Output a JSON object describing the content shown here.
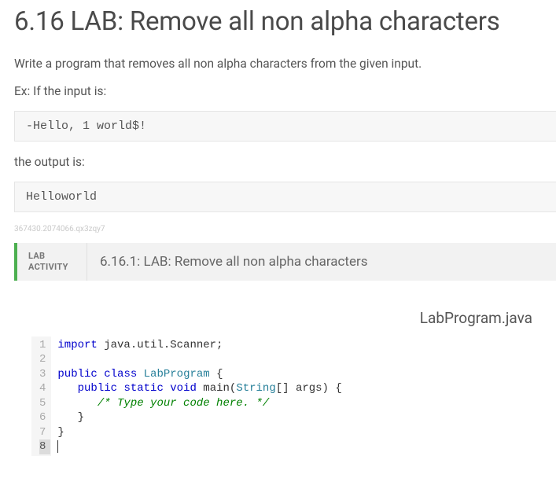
{
  "title": "6.16 LAB: Remove all non alpha characters",
  "instructions": "Write a program that removes all non alpha characters from the given input.",
  "example_intro": "Ex: If the input is:",
  "example_input": "-Hello, 1 world$!",
  "output_intro": "the output is:",
  "example_output": "Helloworld",
  "tiny_id": "367430.2074066.qx3zqy7",
  "lab": {
    "badge_line1": "LAB",
    "badge_line2": "ACTIVITY",
    "header_title": "6.16.1: LAB: Remove all non alpha characters"
  },
  "filename": "LabProgram.java",
  "code": {
    "lines": [
      {
        "n": 1,
        "tokens": [
          [
            "kw",
            "import"
          ],
          [
            "",
            " java.util.Scanner;"
          ]
        ]
      },
      {
        "n": 2,
        "tokens": []
      },
      {
        "n": 3,
        "tokens": [
          [
            "kw",
            "public"
          ],
          [
            "",
            " "
          ],
          [
            "kw",
            "class"
          ],
          [
            "",
            " "
          ],
          [
            "typ",
            "LabProgram"
          ],
          [
            "",
            " {"
          ]
        ]
      },
      {
        "n": 4,
        "tokens": [
          [
            "",
            "   "
          ],
          [
            "kw",
            "public"
          ],
          [
            "",
            " "
          ],
          [
            "kw",
            "static"
          ],
          [
            "",
            " "
          ],
          [
            "kw",
            "void"
          ],
          [
            "",
            " "
          ],
          [
            "fn",
            "main"
          ],
          [
            "",
            "("
          ],
          [
            "typ",
            "String"
          ],
          [
            "",
            "[] args) {"
          ]
        ]
      },
      {
        "n": 5,
        "tokens": [
          [
            "",
            "      "
          ],
          [
            "cmt",
            "/* Type your code here. */"
          ]
        ]
      },
      {
        "n": 6,
        "tokens": [
          [
            "",
            "   }"
          ]
        ]
      },
      {
        "n": 7,
        "tokens": [
          [
            "",
            "}"
          ]
        ]
      },
      {
        "n": 8,
        "tokens": [],
        "cursor": true
      }
    ]
  }
}
